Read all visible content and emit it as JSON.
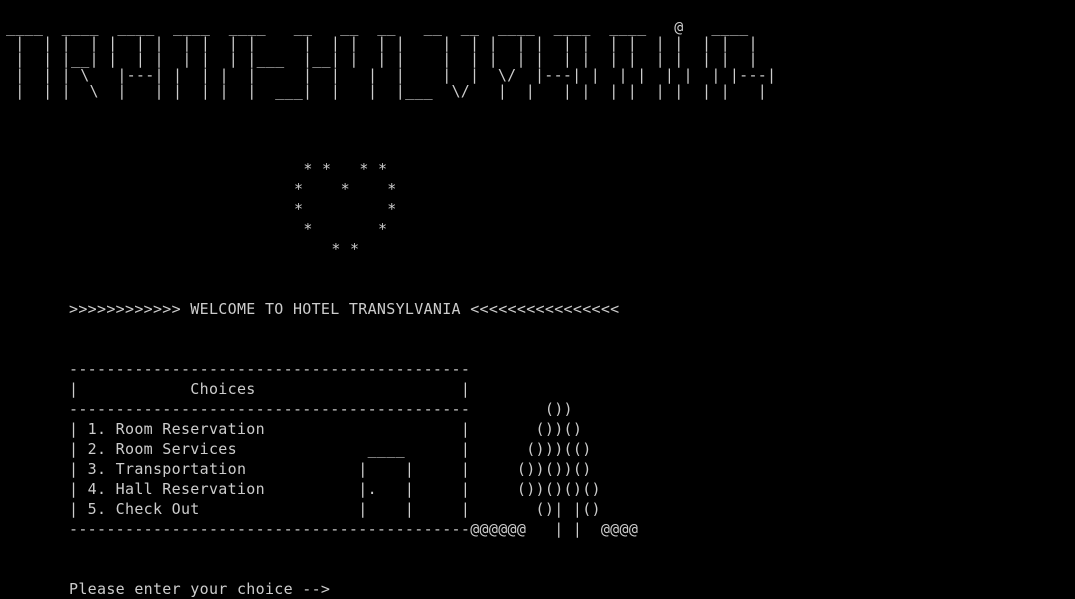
{
  "terminal": {
    "background": "#000000",
    "foreground": "#cccccc"
  },
  "banner_art": "____  ____  ____  ____  ____   __   __  __   __  __  ____  ____  ____   @   ____\n |  | |  | |  | |  | |  | |     |  | |  | |    |  | |  | |  | |  | |  | |  | |  |\n |  | |__| |  | |  | |  | |___  |__| |  | |    |  | |  | |  | |  | |  | |  | |  |\n |  | | \\   |---| |  | |  |     |  |   |  |    |  |  \\/  |---| |  | |  | |  | |---|\n |  | |  \\  |   | |  | |  |  ___|  |   |  |___  \\/   |  |   | |  | |  | |  | |   |",
  "heart_art": " * *   * *\n*    *    *\n*         *\n *       *\n    * *",
  "welcome": {
    "line": ">>>>>>>>>>>> WELCOME TO HOTEL TRANSYLVANIA <<<<<<<<<<<<<<<<"
  },
  "menu": {
    "box": "-------------------------------------------\n|            Choices                      |\n-------------------------------------------        ())\n| 1. Room Reservation                     |       ())()\n| 2. Room Services              ____      |      ()))(()\n| 3. Transportation            |    |     |     ())())()\n| 4. Hall Reservation          |.   |     |     ())()()()\n| 5. Check Out                 |    |     |       ()| |()\n-------------------------------------------@@@@@@   | |  @@@@"
  },
  "prompt": {
    "text": "Please enter your choice -->"
  }
}
